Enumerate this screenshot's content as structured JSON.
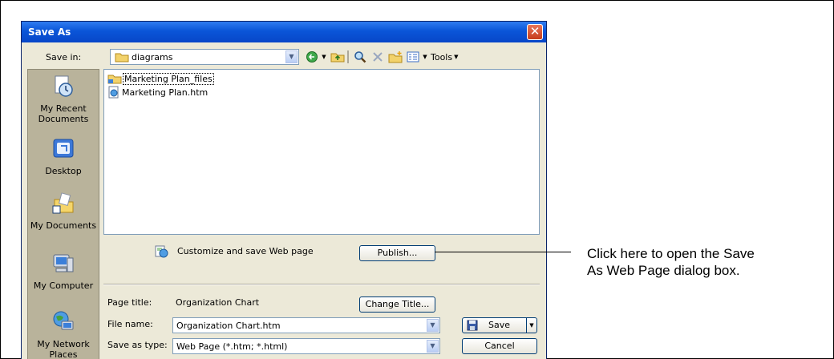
{
  "dialog": {
    "title": "Save As",
    "close_glyph": "✕",
    "save_in_label": "Save in:",
    "save_in_value": "diagrams",
    "tools_label": "Tools"
  },
  "places": [
    {
      "label": "My Recent Documents",
      "icon": "recent-documents-icon"
    },
    {
      "label": "Desktop",
      "icon": "desktop-icon"
    },
    {
      "label": "My Documents",
      "icon": "my-documents-icon"
    },
    {
      "label": "My Computer",
      "icon": "my-computer-icon"
    },
    {
      "label": "My Network Places",
      "icon": "network-places-icon"
    }
  ],
  "files": [
    {
      "name": "Marketing Plan_files",
      "type": "folder"
    },
    {
      "name": "Marketing Plan.htm",
      "type": "htm"
    }
  ],
  "publish": {
    "customize_label": "Customize and save Web page",
    "publish_button": "Publish..."
  },
  "form": {
    "page_title_label": "Page title:",
    "page_title_value": "Organization Chart",
    "change_title_button": "Change Title...",
    "file_name_label": "File name:",
    "file_name_value": "Organization Chart.htm",
    "save_as_type_label": "Save as type:",
    "save_as_type_value": "Web Page (*.htm; *.html)",
    "save_button": "Save",
    "cancel_button": "Cancel"
  },
  "callout": {
    "line1": "Click here to open the Save",
    "line2": "As Web Page dialog box."
  },
  "colors": {
    "titlebar": "#0a55d8",
    "dialog_bg": "#ece9d8",
    "places_bar": "#b9b39b",
    "close_button": "#c63c1b"
  }
}
